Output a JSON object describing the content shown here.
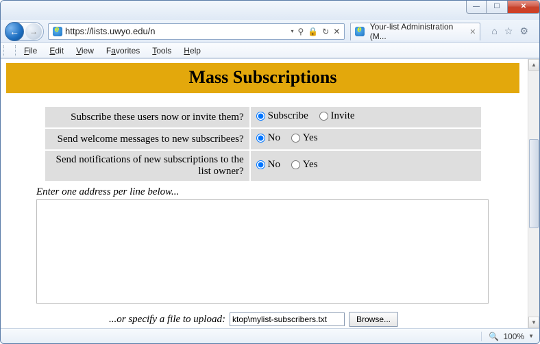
{
  "browser": {
    "url": "https://lists.uwyo.edu/n",
    "tab_title": "Your-list Administration (M...",
    "menu": {
      "file": "File",
      "edit": "Edit",
      "view": "View",
      "favorites": "Favorites",
      "tools": "Tools",
      "help": "Help"
    },
    "zoom": "100%"
  },
  "page": {
    "heading": "Mass Subscriptions",
    "options": [
      {
        "label": "Subscribe these users now or invite them?",
        "choices": [
          "Subscribe",
          "Invite"
        ],
        "selected": "Subscribe"
      },
      {
        "label": "Send welcome messages to new subscribees?",
        "choices": [
          "No",
          "Yes"
        ],
        "selected": "No"
      },
      {
        "label": "Send notifications of new subscriptions to the list owner?",
        "choices": [
          "No",
          "Yes"
        ],
        "selected": "No"
      }
    ],
    "addresses_hint": "Enter one address per line below...",
    "addresses_value": "",
    "upload_hint": "...or specify a file to upload:",
    "upload_path": "ktop\\mylist-subscribers.txt",
    "browse_label": "Browse..."
  }
}
